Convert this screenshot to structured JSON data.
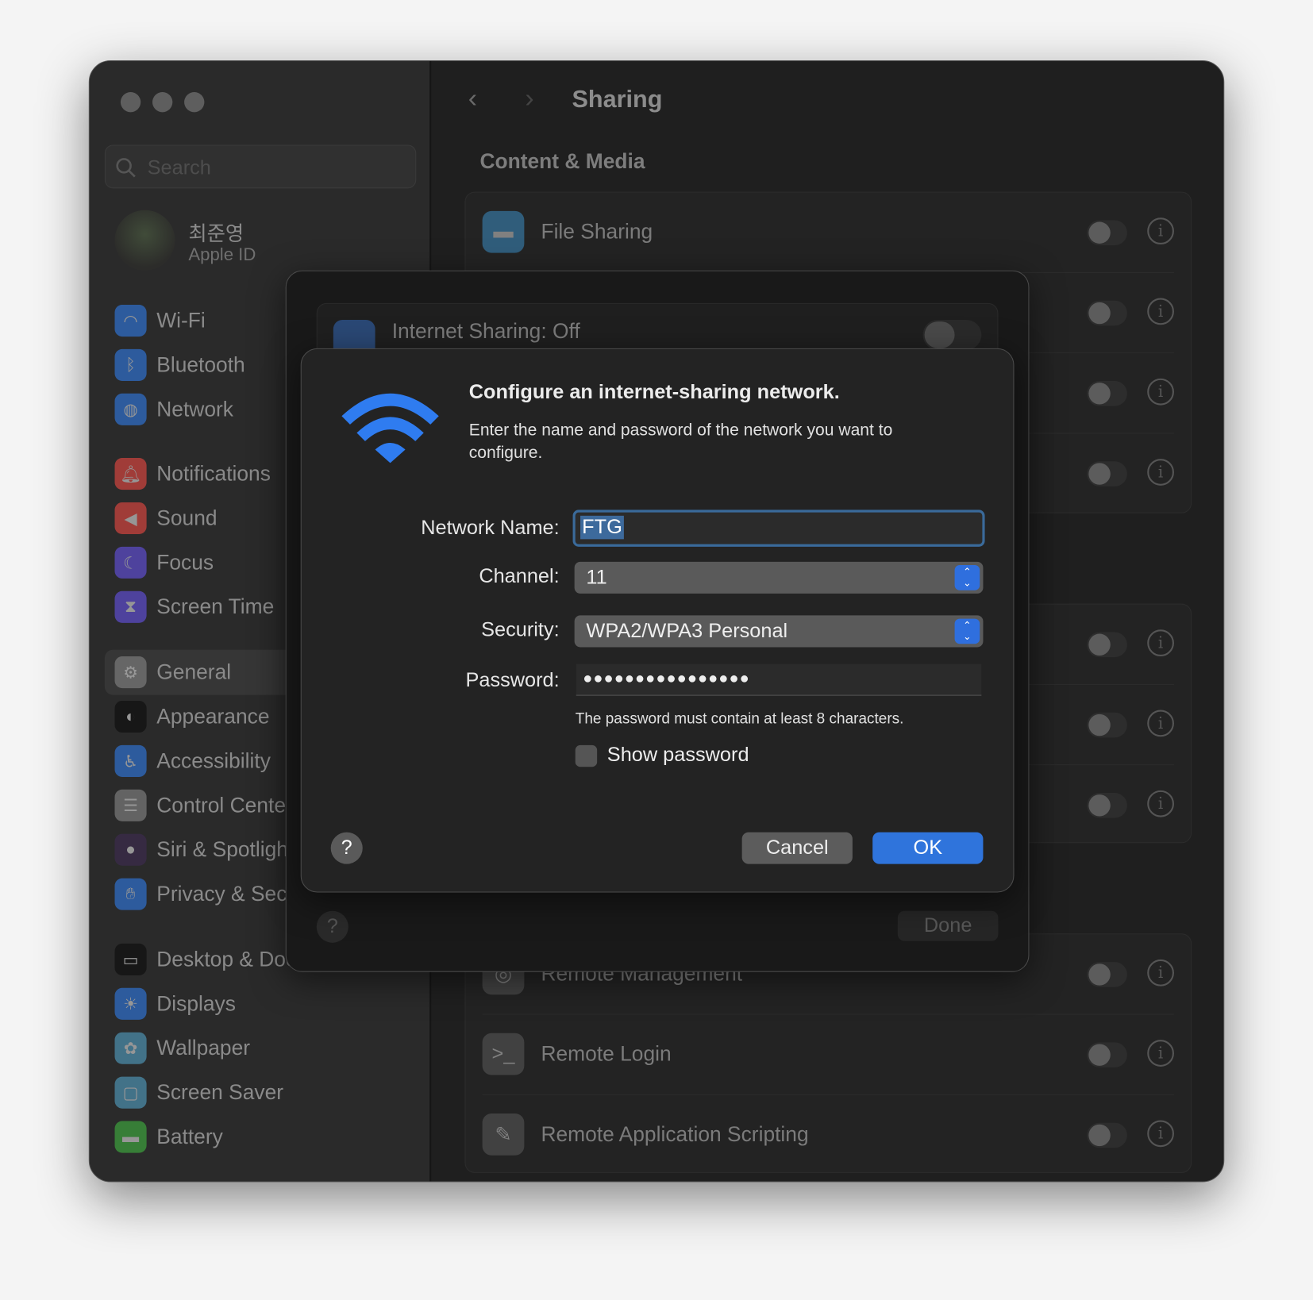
{
  "window": {
    "title": "Sharing"
  },
  "sidebar": {
    "search_placeholder": "Search",
    "user": {
      "name": "최준영",
      "subtitle": "Apple ID"
    },
    "items": [
      {
        "label": "Wi-Fi",
        "icon": "wifi-icon",
        "color": "#2f6cc4"
      },
      {
        "label": "Bluetooth",
        "icon": "bluetooth-icon",
        "color": "#2f6cc4"
      },
      {
        "label": "Network",
        "icon": "globe-icon",
        "color": "#2f6cc4"
      },
      {
        "label": "Notifications",
        "icon": "bell-icon",
        "color": "#c8433d"
      },
      {
        "label": "Sound",
        "icon": "speaker-icon",
        "color": "#c8433d"
      },
      {
        "label": "Focus",
        "icon": "moon-icon",
        "color": "#5a4bc4"
      },
      {
        "label": "Screen Time",
        "icon": "hourglass-icon",
        "color": "#5a4bc4"
      },
      {
        "label": "General",
        "icon": "gear-icon",
        "color": "#777777",
        "selected": true
      },
      {
        "label": "Appearance",
        "icon": "appearance-icon",
        "color": "#111111"
      },
      {
        "label": "Accessibility",
        "icon": "accessibility-icon",
        "color": "#2f6cc4"
      },
      {
        "label": "Control Center",
        "icon": "switches-icon",
        "color": "#777777"
      },
      {
        "label": "Siri & Spotlight",
        "icon": "siri-icon",
        "color": "#3a2a4a"
      },
      {
        "label": "Privacy & Security",
        "icon": "hand-icon",
        "color": "#2f6cc4"
      },
      {
        "label": "Desktop & Dock",
        "icon": "dock-icon",
        "color": "#111111"
      },
      {
        "label": "Displays",
        "icon": "sun-icon",
        "color": "#2f6cc4"
      },
      {
        "label": "Wallpaper",
        "icon": "flower-icon",
        "color": "#4a8aa8"
      },
      {
        "label": "Screen Saver",
        "icon": "screensaver-icon",
        "color": "#4a8aa8"
      },
      {
        "label": "Battery",
        "icon": "battery-icon",
        "color": "#3c9a3c"
      }
    ]
  },
  "main": {
    "section_title": "Content & Media",
    "groups": [
      [
        {
          "label": "File Sharing",
          "icon": "folder-icon",
          "on": false
        },
        {
          "label": "",
          "on": false
        },
        {
          "label": "",
          "on": false
        },
        {
          "label": "",
          "on": false
        }
      ],
      [
        {
          "label": "",
          "on": false
        },
        {
          "label": "",
          "on": false
        },
        {
          "label": "",
          "on": false
        }
      ],
      [
        {
          "label": "Remote Management",
          "icon": "remote-management-icon",
          "on": false
        },
        {
          "label": "Remote Login",
          "icon": "terminal-icon",
          "on": false
        },
        {
          "label": "Remote Application Scripting",
          "icon": "script-icon",
          "on": false
        }
      ]
    ]
  },
  "sheet": {
    "internet_sharing_label": "Internet Sharing: Off",
    "internet_sharing_on": false,
    "help": "?",
    "done": "Done"
  },
  "dialog": {
    "title": "Configure an internet-sharing network.",
    "message": "Enter the name and password of the network you want to configure.",
    "network_name_label": "Network Name:",
    "network_name_value": "FTG",
    "channel_label": "Channel:",
    "channel_value": "11",
    "security_label": "Security:",
    "security_value": "WPA2/WPA3 Personal",
    "password_label": "Password:",
    "password_value": "●●●●●●●●●●●●●●●●",
    "password_hint": "The password must contain at least 8 characters.",
    "show_password_label": "Show password",
    "show_password_checked": false,
    "help": "?",
    "cancel": "Cancel",
    "ok": "OK",
    "accent": "#2f6fde"
  }
}
